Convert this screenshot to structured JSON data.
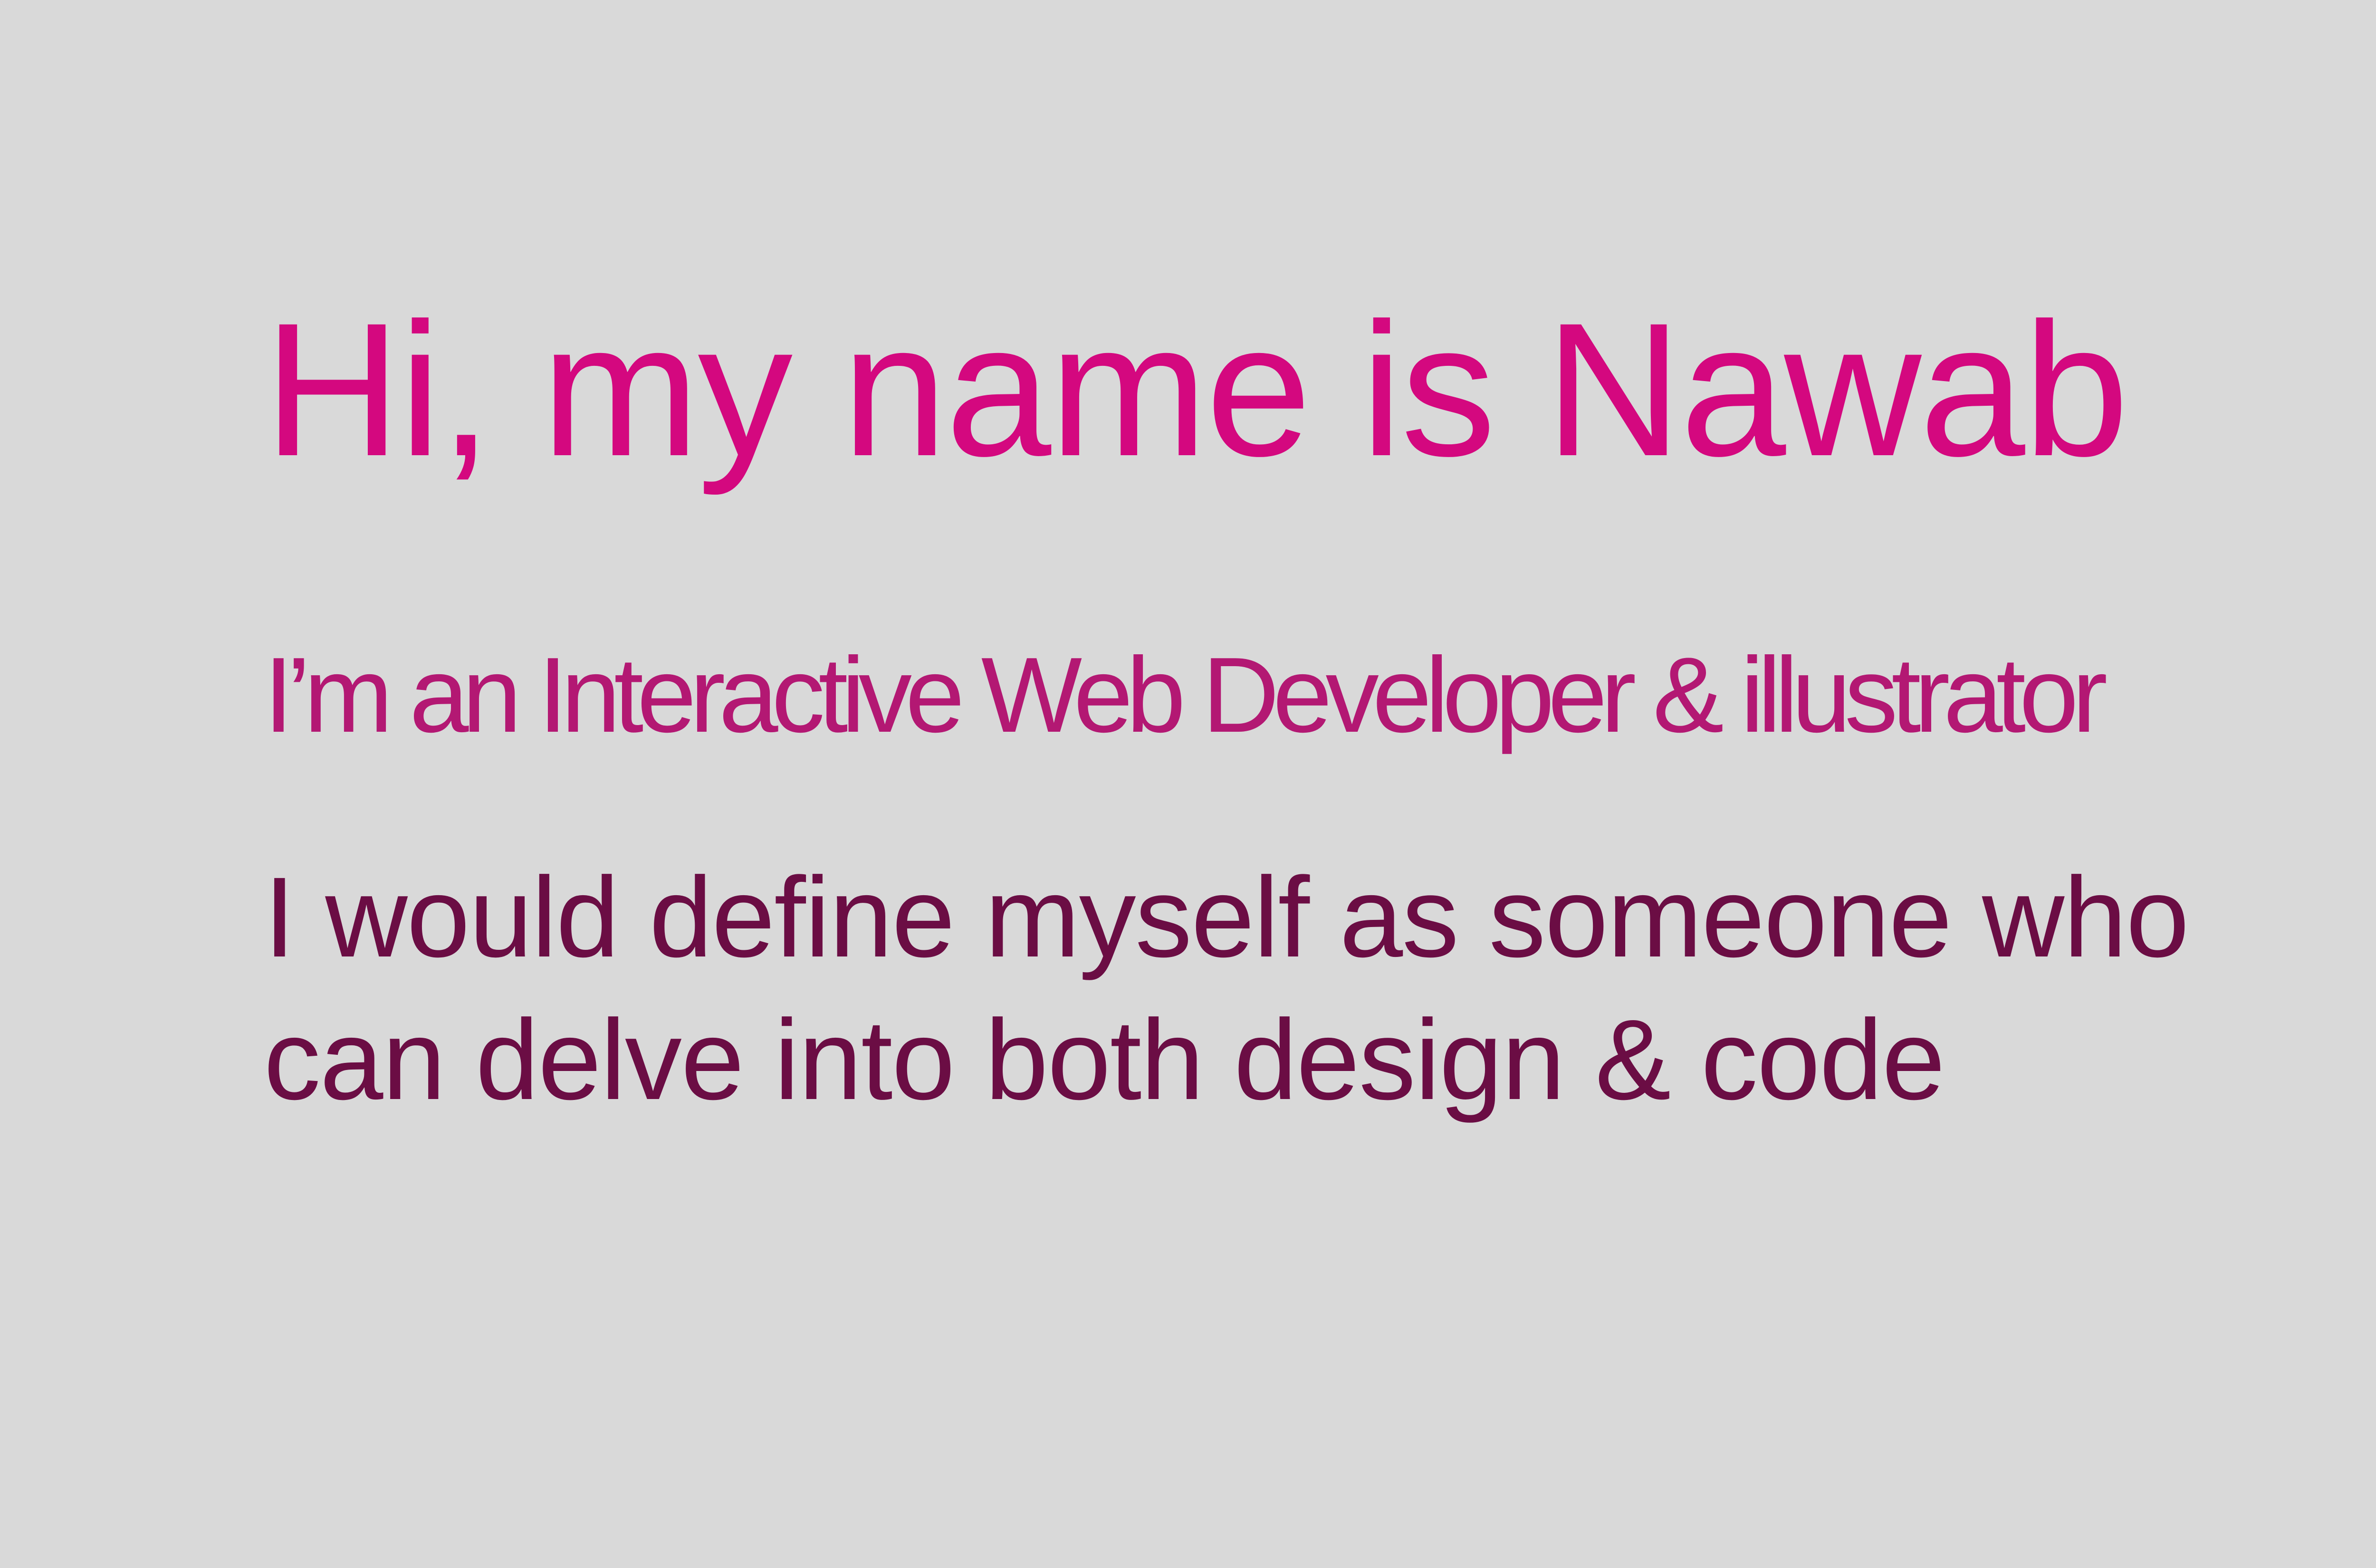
{
  "page": {
    "background": "#d9d9d9"
  },
  "intro": {
    "headline": "Hi, my name is Nawab",
    "subtitle": "I’m an Interactive Web Developer & illustrator",
    "description_lines": [
      "I would define myself as someone who",
      "can delve into both design & code"
    ]
  },
  "colors": {
    "headline": "#d4087f",
    "subtitle": "#b31873",
    "description": "#6b0d44"
  }
}
